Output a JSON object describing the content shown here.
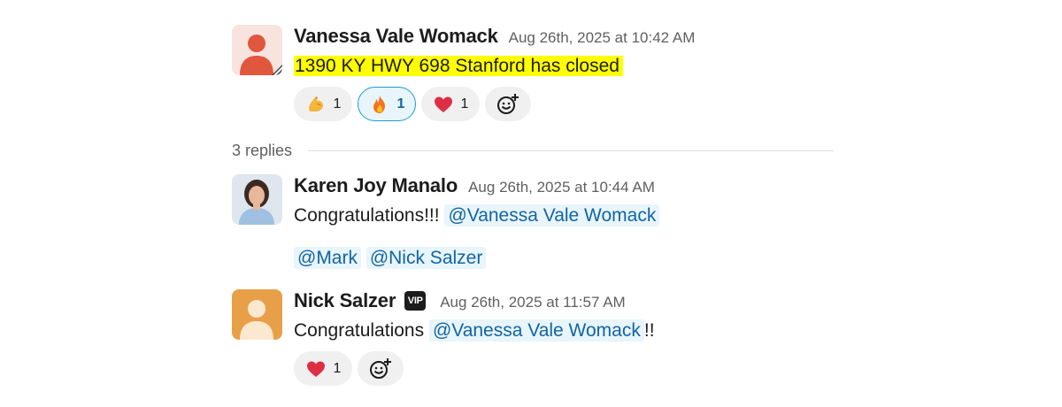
{
  "colors": {
    "highlight": "#ffff00",
    "mention": "#1264a3",
    "mention_bg": "#e8f5fa",
    "active_reaction_border": "#1d9bd1"
  },
  "messages": [
    {
      "author": "Vanessa Vale Womack",
      "timestamp": "Aug 26th, 2025 at 10:42 AM",
      "text": "1390 KY HWY 698 Stanford has closed",
      "reactions": [
        {
          "emoji": "flexed-biceps",
          "count": "1",
          "active": false
        },
        {
          "emoji": "fire",
          "count": "1",
          "active": true
        },
        {
          "emoji": "red-heart",
          "count": "1",
          "active": false
        }
      ]
    }
  ],
  "thread": {
    "replies_label": "3 replies",
    "replies": [
      {
        "author": "Karen Joy Manalo",
        "timestamp": "Aug 26th, 2025 at 10:44 AM",
        "text": "Congratulations!!! ",
        "mentions": [
          "@Vanessa Vale Womack",
          "@Mark",
          "@Nick Salzer"
        ]
      },
      {
        "author": "Nick Salzer",
        "badge": "VIP",
        "timestamp": "Aug 26th, 2025 at 11:57 AM",
        "text": "Congratulations ",
        "mentions": [
          "@Vanessa Vale Womack"
        ],
        "suffix": "!!",
        "reactions": [
          {
            "emoji": "red-heart",
            "count": "1",
            "active": false
          }
        ]
      }
    ]
  }
}
